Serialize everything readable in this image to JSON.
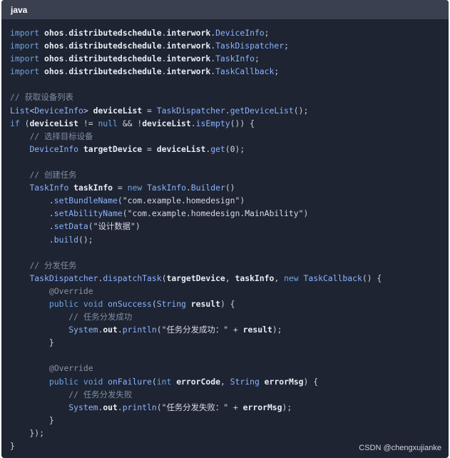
{
  "header": {
    "language": "java"
  },
  "watermark": "CSDN @chengxujianke",
  "code_lines": [
    [
      [
        "kw",
        "import "
      ],
      [
        "id",
        "ohos"
      ],
      [
        "pl",
        "."
      ],
      [
        "id",
        "distributedschedule"
      ],
      [
        "pl",
        "."
      ],
      [
        "id",
        "interwork"
      ],
      [
        "pl",
        "."
      ],
      [
        "ty",
        "DeviceInfo"
      ],
      [
        "pl",
        ";"
      ]
    ],
    [
      [
        "kw",
        "import "
      ],
      [
        "id",
        "ohos"
      ],
      [
        "pl",
        "."
      ],
      [
        "id",
        "distributedschedule"
      ],
      [
        "pl",
        "."
      ],
      [
        "id",
        "interwork"
      ],
      [
        "pl",
        "."
      ],
      [
        "ty",
        "TaskDispatcher"
      ],
      [
        "pl",
        ";"
      ]
    ],
    [
      [
        "kw",
        "import "
      ],
      [
        "id",
        "ohos"
      ],
      [
        "pl",
        "."
      ],
      [
        "id",
        "distributedschedule"
      ],
      [
        "pl",
        "."
      ],
      [
        "id",
        "interwork"
      ],
      [
        "pl",
        "."
      ],
      [
        "ty",
        "TaskInfo"
      ],
      [
        "pl",
        ";"
      ]
    ],
    [
      [
        "kw",
        "import "
      ],
      [
        "id",
        "ohos"
      ],
      [
        "pl",
        "."
      ],
      [
        "id",
        "distributedschedule"
      ],
      [
        "pl",
        "."
      ],
      [
        "id",
        "interwork"
      ],
      [
        "pl",
        "."
      ],
      [
        "ty",
        "TaskCallback"
      ],
      [
        "pl",
        ";"
      ]
    ],
    [],
    [
      [
        "cm",
        "// 获取设备列表"
      ]
    ],
    [
      [
        "ty",
        "List"
      ],
      [
        "pl",
        "<"
      ],
      [
        "ty",
        "DeviceInfo"
      ],
      [
        "pl",
        "> "
      ],
      [
        "id",
        "deviceList"
      ],
      [
        "pl",
        " = "
      ],
      [
        "ty",
        "TaskDispatcher"
      ],
      [
        "pl",
        "."
      ],
      [
        "ty",
        "getDeviceList"
      ],
      [
        "pl",
        "();"
      ]
    ],
    [
      [
        "kw",
        "if"
      ],
      [
        "pl",
        " ("
      ],
      [
        "id",
        "deviceList"
      ],
      [
        "pl",
        " != "
      ],
      [
        "kw",
        "null"
      ],
      [
        "pl",
        " && !"
      ],
      [
        "id",
        "deviceList"
      ],
      [
        "pl",
        "."
      ],
      [
        "ty",
        "isEmpty"
      ],
      [
        "pl",
        "()) {"
      ]
    ],
    [
      [
        "pl",
        "    "
      ],
      [
        "cm",
        "// 选择目标设备"
      ]
    ],
    [
      [
        "pl",
        "    "
      ],
      [
        "ty",
        "DeviceInfo"
      ],
      [
        "pl",
        " "
      ],
      [
        "id",
        "targetDevice"
      ],
      [
        "pl",
        " = "
      ],
      [
        "id",
        "deviceList"
      ],
      [
        "pl",
        "."
      ],
      [
        "ty",
        "get"
      ],
      [
        "pl",
        "("
      ],
      [
        "num",
        "0"
      ],
      [
        "pl",
        ");"
      ]
    ],
    [],
    [
      [
        "pl",
        "    "
      ],
      [
        "cm",
        "// 创建任务"
      ]
    ],
    [
      [
        "pl",
        "    "
      ],
      [
        "ty",
        "TaskInfo"
      ],
      [
        "pl",
        " "
      ],
      [
        "id",
        "taskInfo"
      ],
      [
        "pl",
        " = "
      ],
      [
        "kw",
        "new"
      ],
      [
        "pl",
        " "
      ],
      [
        "ty",
        "TaskInfo"
      ],
      [
        "pl",
        "."
      ],
      [
        "ty",
        "Builder"
      ],
      [
        "pl",
        "()"
      ]
    ],
    [
      [
        "pl",
        "        ."
      ],
      [
        "ty",
        "setBundleName"
      ],
      [
        "pl",
        "("
      ],
      [
        "str",
        "\"com.example.homedesign\""
      ],
      [
        "pl",
        ")"
      ]
    ],
    [
      [
        "pl",
        "        ."
      ],
      [
        "ty",
        "setAbilityName"
      ],
      [
        "pl",
        "("
      ],
      [
        "str",
        "\"com.example.homedesign.MainAbility\""
      ],
      [
        "pl",
        ")"
      ]
    ],
    [
      [
        "pl",
        "        ."
      ],
      [
        "ty",
        "setData"
      ],
      [
        "pl",
        "("
      ],
      [
        "str",
        "\"设计数据\""
      ],
      [
        "pl",
        ")"
      ]
    ],
    [
      [
        "pl",
        "        ."
      ],
      [
        "ty",
        "build"
      ],
      [
        "pl",
        "();"
      ]
    ],
    [],
    [
      [
        "pl",
        "    "
      ],
      [
        "cm",
        "// 分发任务"
      ]
    ],
    [
      [
        "pl",
        "    "
      ],
      [
        "ty",
        "TaskDispatcher"
      ],
      [
        "pl",
        "."
      ],
      [
        "ty",
        "dispatchTask"
      ],
      [
        "pl",
        "("
      ],
      [
        "id",
        "targetDevice"
      ],
      [
        "pl",
        ", "
      ],
      [
        "id",
        "taskInfo"
      ],
      [
        "pl",
        ", "
      ],
      [
        "kw",
        "new"
      ],
      [
        "pl",
        " "
      ],
      [
        "ty",
        "TaskCallback"
      ],
      [
        "pl",
        "() {"
      ]
    ],
    [
      [
        "pl",
        "        "
      ],
      [
        "an",
        "@Override"
      ]
    ],
    [
      [
        "pl",
        "        "
      ],
      [
        "kw",
        "public void "
      ],
      [
        "ty",
        "onSuccess"
      ],
      [
        "pl",
        "("
      ],
      [
        "ty",
        "String"
      ],
      [
        "pl",
        " "
      ],
      [
        "id",
        "result"
      ],
      [
        "pl",
        ") {"
      ]
    ],
    [
      [
        "pl",
        "            "
      ],
      [
        "cm",
        "// 任务分发成功"
      ]
    ],
    [
      [
        "pl",
        "            "
      ],
      [
        "ty",
        "System"
      ],
      [
        "pl",
        "."
      ],
      [
        "id",
        "out"
      ],
      [
        "pl",
        "."
      ],
      [
        "ty",
        "println"
      ],
      [
        "pl",
        "("
      ],
      [
        "str",
        "\"任务分发成功：\""
      ],
      [
        "pl",
        " + "
      ],
      [
        "id",
        "result"
      ],
      [
        "pl",
        ");"
      ]
    ],
    [
      [
        "pl",
        "        }"
      ]
    ],
    [],
    [
      [
        "pl",
        "        "
      ],
      [
        "an",
        "@Override"
      ]
    ],
    [
      [
        "pl",
        "        "
      ],
      [
        "kw",
        "public void "
      ],
      [
        "ty",
        "onFailure"
      ],
      [
        "pl",
        "("
      ],
      [
        "kw",
        "int"
      ],
      [
        "pl",
        " "
      ],
      [
        "id",
        "errorCode"
      ],
      [
        "pl",
        ", "
      ],
      [
        "ty",
        "String"
      ],
      [
        "pl",
        " "
      ],
      [
        "id",
        "errorMsg"
      ],
      [
        "pl",
        ") {"
      ]
    ],
    [
      [
        "pl",
        "            "
      ],
      [
        "cm",
        "// 任务分发失败"
      ]
    ],
    [
      [
        "pl",
        "            "
      ],
      [
        "ty",
        "System"
      ],
      [
        "pl",
        "."
      ],
      [
        "id",
        "out"
      ],
      [
        "pl",
        "."
      ],
      [
        "ty",
        "println"
      ],
      [
        "pl",
        "("
      ],
      [
        "str",
        "\"任务分发失败：\""
      ],
      [
        "pl",
        " + "
      ],
      [
        "id",
        "errorMsg"
      ],
      [
        "pl",
        ");"
      ]
    ],
    [
      [
        "pl",
        "        }"
      ]
    ],
    [
      [
        "pl",
        "    });"
      ]
    ],
    [
      [
        "pl",
        "}"
      ]
    ]
  ]
}
